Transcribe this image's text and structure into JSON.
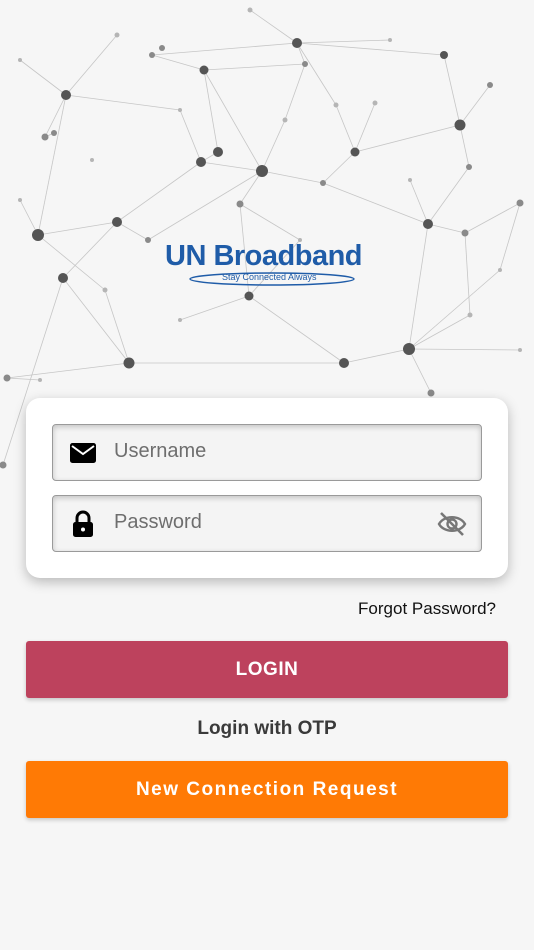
{
  "brand": {
    "name": "UN Broadband",
    "tagline": "Stay Connected Always",
    "color": "#1f5ca8"
  },
  "login_form": {
    "username_placeholder": "Username",
    "password_placeholder": "Password",
    "username_icon": "envelope-icon",
    "password_icon": "lock-icon",
    "visibility_icon": "eye-off-icon"
  },
  "links": {
    "forgot_password": "Forgot Password?",
    "login_with_otp": "Login with OTP"
  },
  "buttons": {
    "login": "LOGIN",
    "new_connection": "New Connection Request"
  },
  "colors": {
    "login_button": "#bd425d",
    "new_connection_button": "#ff7a05",
    "background": "#f6f6f6"
  }
}
